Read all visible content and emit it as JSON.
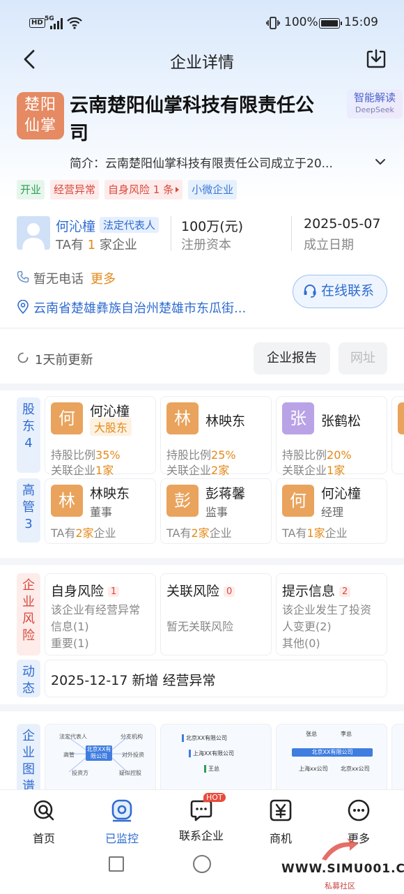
{
  "status_bar": {
    "network": "HD",
    "signal": "5G",
    "battery": "100%",
    "time": "15:09"
  },
  "header": {
    "title": "企业详情"
  },
  "company": {
    "logo_text_1": "楚阳",
    "logo_text_2": "仙掌",
    "name_line_1": "云南楚阳仙掌科技有限责任公",
    "name_line_2": "司",
    "ai_label": "智能解读",
    "ai_sub": "DeepSeek",
    "intro": "简介：云南楚阳仙掌科技有限责任公司成立于20...",
    "tags": [
      "开业",
      "经营异常",
      "自身风险 1 条",
      "小微企业"
    ]
  },
  "legal_rep": {
    "name": "何沁橦",
    "badge": "法定代表人",
    "sub_prefix": "TA有",
    "sub_count": "1",
    "sub_suffix": "家企业"
  },
  "capital": {
    "value": "100万(元)",
    "label": "注册资本"
  },
  "founded": {
    "value": "2025-05-07",
    "label": "成立日期"
  },
  "contact": {
    "phone": "暂无电话",
    "more": "更多",
    "address": "云南省楚雄彝族自治州楚雄市东瓜街...",
    "online_button": "在线联系"
  },
  "update": {
    "text": "1天前更新",
    "report_button": "企业报告",
    "web_button": "网址"
  },
  "shareholders": {
    "label_1": "股",
    "label_2": "东",
    "count": "4",
    "items": [
      {
        "avatar": "何",
        "name": "何沁橦",
        "badge": "大股东",
        "ratio_label": "持股比例",
        "ratio": "35%",
        "rel_label": "关联企业",
        "rel": "1家"
      },
      {
        "avatar": "林",
        "name": "林映东",
        "badge": "",
        "ratio_label": "持股比例",
        "ratio": "25%",
        "rel_label": "关联企业",
        "rel": "2家"
      },
      {
        "avatar": "张",
        "name": "张鹤松",
        "badge": "",
        "ratio_label": "持股比例",
        "ratio": "20%",
        "rel_label": "关联企业",
        "rel": "1家"
      }
    ]
  },
  "executives": {
    "label_1": "高",
    "label_2": "管",
    "count": "3",
    "items": [
      {
        "avatar": "林",
        "name": "林映东",
        "role": "董事",
        "pre": "TA有",
        "num": "2家",
        "post": "企业"
      },
      {
        "avatar": "彭",
        "name": "彭蒋馨",
        "role": "监事",
        "pre": "TA有",
        "num": "2家",
        "post": "企业"
      },
      {
        "avatar": "何",
        "name": "何沁橦",
        "role": "经理",
        "pre": "TA有",
        "num": "1家",
        "post": "企业"
      }
    ]
  },
  "risk": {
    "label": [
      "企",
      "业",
      "风",
      "险"
    ],
    "items": [
      {
        "title": "自身风险",
        "count": "1",
        "line1": "该企业有经营异常",
        "line2": "信息(1)",
        "line3": "重要(1)"
      },
      {
        "title": "关联风险",
        "count": "0",
        "line1": "暂无关联风险",
        "line2": "",
        "line3": ""
      },
      {
        "title": "提示信息",
        "count": "2",
        "line1": "该企业发生了投资",
        "line2": "人变更(2)",
        "line3": "其他(0)"
      }
    ]
  },
  "dynamics": {
    "label": [
      "动",
      "态"
    ],
    "text": "2025-12-17 新增 经营异常"
  },
  "graph": {
    "label": [
      "企",
      "业",
      "图",
      "谱"
    ],
    "card1": {
      "center": "北京XX有限公司",
      "nodes": [
        "法定代表人",
        "分支机构",
        "高管",
        "对外投资",
        "投资方",
        "疑似控股"
      ]
    },
    "card2": {
      "rows": [
        "北京XX有限公司",
        "上海XX有限公司",
        "王总"
      ]
    },
    "card3": {
      "top": [
        "张总",
        "李总"
      ],
      "center": "北京XX有限公司",
      "bottom": [
        "上海xx公司",
        "北京xx公司"
      ]
    }
  },
  "tabs": [
    {
      "label": "首页",
      "icon": "search-icon"
    },
    {
      "label": "已监控",
      "icon": "monitor-icon"
    },
    {
      "label": "联系企业",
      "icon": "chat-icon",
      "badge": "HOT"
    },
    {
      "label": "商机",
      "icon": "yen-icon"
    },
    {
      "label": "更多",
      "icon": "more-icon"
    }
  ],
  "watermark": {
    "site": "WWW.SIMU001.CN",
    "sub": "私募社区"
  },
  "colors": {
    "accent": "#2f6bd0",
    "orange": "#e38a19",
    "red": "#d9483b",
    "green": "#2e9e55"
  }
}
